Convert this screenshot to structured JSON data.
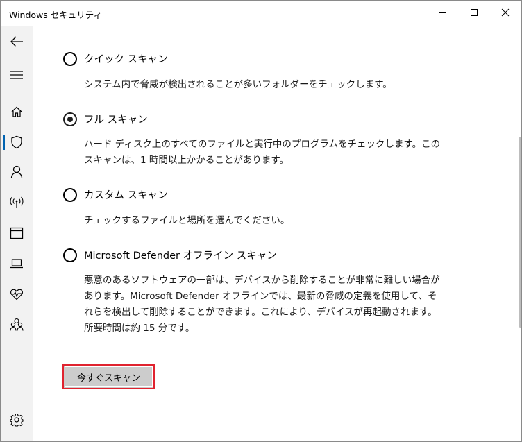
{
  "window": {
    "title": "Windows セキュリティ"
  },
  "sidebar": {
    "items": [
      {
        "icon": "back-arrow-icon"
      },
      {
        "icon": "hamburger-menu-icon"
      },
      {
        "icon": "home-icon"
      },
      {
        "icon": "shield-icon",
        "active": true
      },
      {
        "icon": "person-icon"
      },
      {
        "icon": "wireless-antenna-icon"
      },
      {
        "icon": "app-browser-icon"
      },
      {
        "icon": "laptop-icon"
      },
      {
        "icon": "heart-pulse-icon"
      },
      {
        "icon": "family-icon"
      },
      {
        "icon": "gear-icon"
      }
    ]
  },
  "scan_options": [
    {
      "label": "クイック スキャン",
      "description": "システム内で脅威が検出されることが多いフォルダーをチェックします。",
      "selected": false
    },
    {
      "label": "フル スキャン",
      "description": "ハード ディスク上のすべてのファイルと実行中のプログラムをチェックします。このスキャンは、1 時間以上かかることがあります。",
      "selected": true
    },
    {
      "label": "カスタム スキャン",
      "description": "チェックするファイルと場所を選んでください。",
      "selected": false
    },
    {
      "label": "Microsoft Defender オフライン スキャン",
      "description": "悪意のあるソフトウェアの一部は、デバイスから削除することが非常に難しい場合があります。Microsoft Defender オフラインでは、最新の脅威の定義を使用して、それらを検出して削除することができます。これにより、デバイスが再起動されます。所要時間は約 15 分です。",
      "selected": false
    }
  ],
  "scan_button": {
    "label": "今すぐスキャン"
  },
  "colors": {
    "accent": "#0063b1",
    "highlight_border": "#e0232f",
    "sidebar_bg": "#f2f2f2",
    "button_bg": "#cccccc"
  }
}
